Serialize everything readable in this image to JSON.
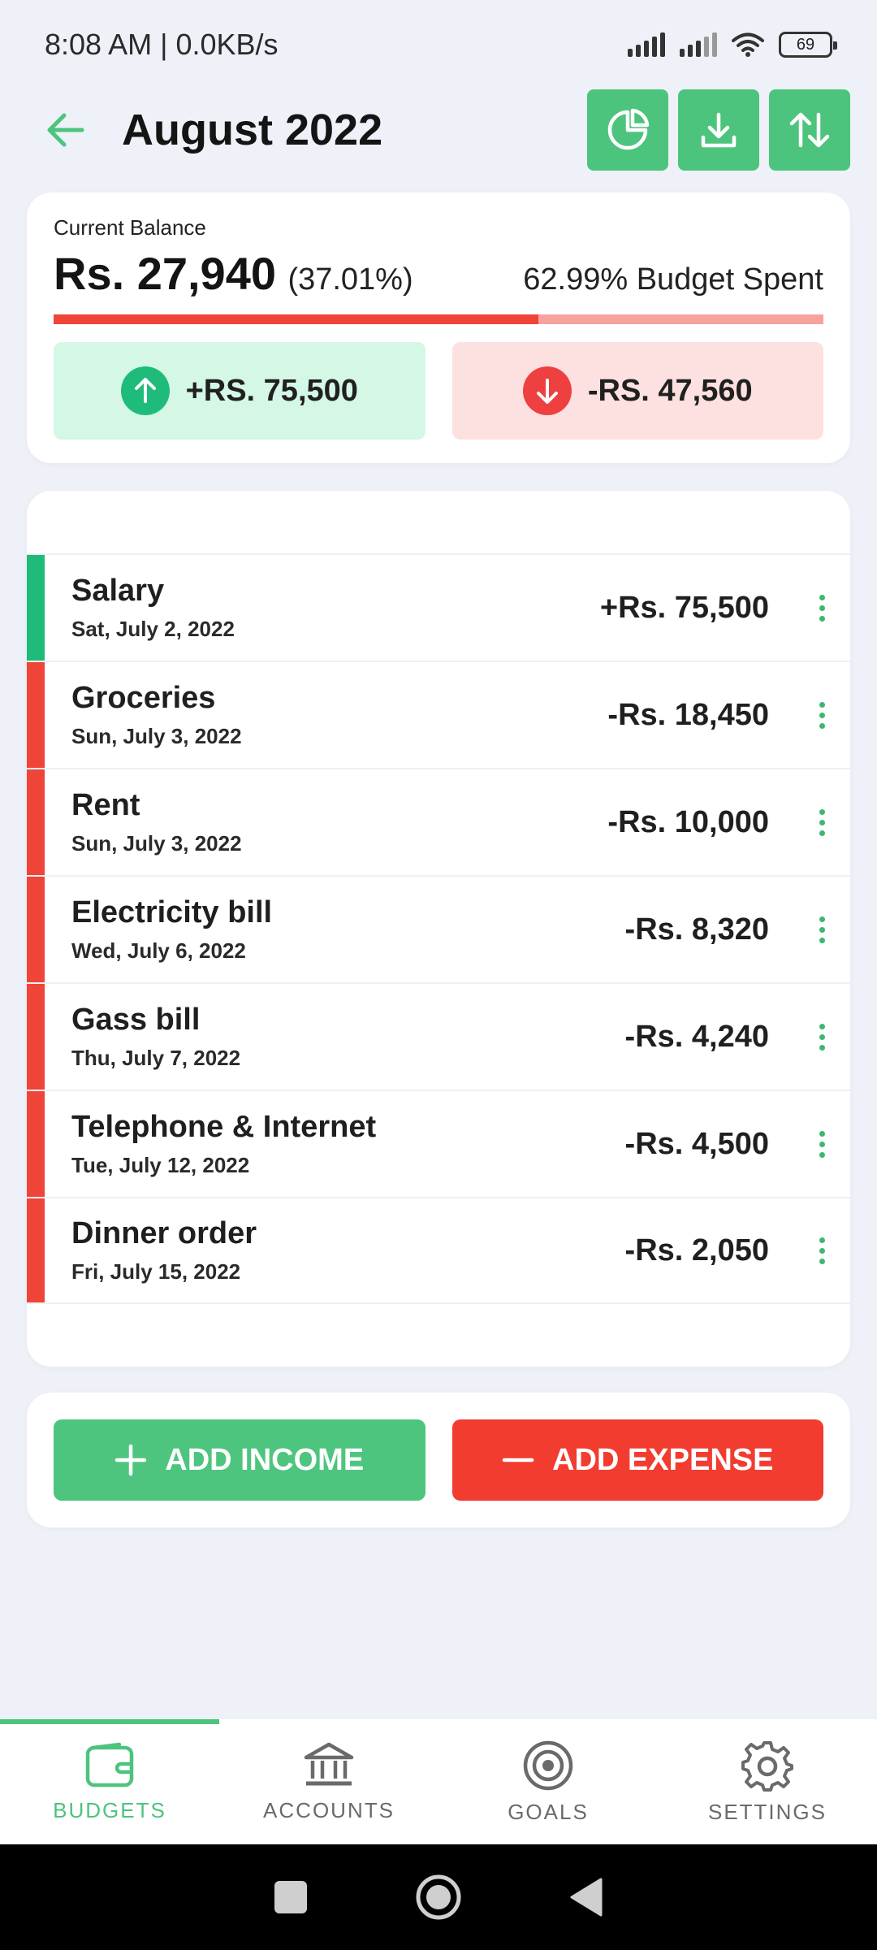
{
  "status": {
    "time_speed": "8:08 AM | 0.0KB/s",
    "battery": "69"
  },
  "header": {
    "title": "August 2022",
    "icons": [
      "back-arrow-icon",
      "pie-chart-icon",
      "download-icon",
      "sort-icon"
    ]
  },
  "balance": {
    "label": "Current Balance",
    "amount": "Rs. 27,940",
    "percent": "(37.01%)",
    "spent": "62.99% Budget Spent",
    "spent_fraction": 0.6299,
    "income": "+RS. 75,500",
    "expense": "-RS. 47,560"
  },
  "transactions": [
    {
      "name": "Salary",
      "date": "Sat, July 2, 2022",
      "amount": "+Rs. 75,500",
      "type": "income"
    },
    {
      "name": "Groceries",
      "date": "Sun, July 3, 2022",
      "amount": "-Rs. 18,450",
      "type": "expense"
    },
    {
      "name": "Rent",
      "date": "Sun, July 3, 2022",
      "amount": "-Rs. 10,000",
      "type": "expense"
    },
    {
      "name": "Electricity bill",
      "date": "Wed, July 6, 2022",
      "amount": "-Rs. 8,320",
      "type": "expense"
    },
    {
      "name": "Gass bill",
      "date": "Thu, July 7, 2022",
      "amount": "-Rs. 4,240",
      "type": "expense"
    },
    {
      "name": "Telephone & Internet",
      "date": "Tue, July 12, 2022",
      "amount": "-Rs. 4,500",
      "type": "expense"
    },
    {
      "name": "Dinner order",
      "date": "Fri, July 15, 2022",
      "amount": "-Rs. 2,050",
      "type": "expense"
    }
  ],
  "actions": {
    "add_income": "ADD INCOME",
    "add_expense": "ADD EXPENSE"
  },
  "nav": [
    {
      "label": "BUDGETS",
      "icon": "wallet-icon",
      "active": true
    },
    {
      "label": "ACCOUNTS",
      "icon": "bank-icon",
      "active": false
    },
    {
      "label": "GOALS",
      "icon": "target-icon",
      "active": false
    },
    {
      "label": "SETTINGS",
      "icon": "gear-icon",
      "active": false
    }
  ],
  "colors": {
    "accent_green": "#4dc47d",
    "income_bar": "#1fbb7a",
    "expense_bar": "#ef4438",
    "expense_button": "#f23c30"
  }
}
